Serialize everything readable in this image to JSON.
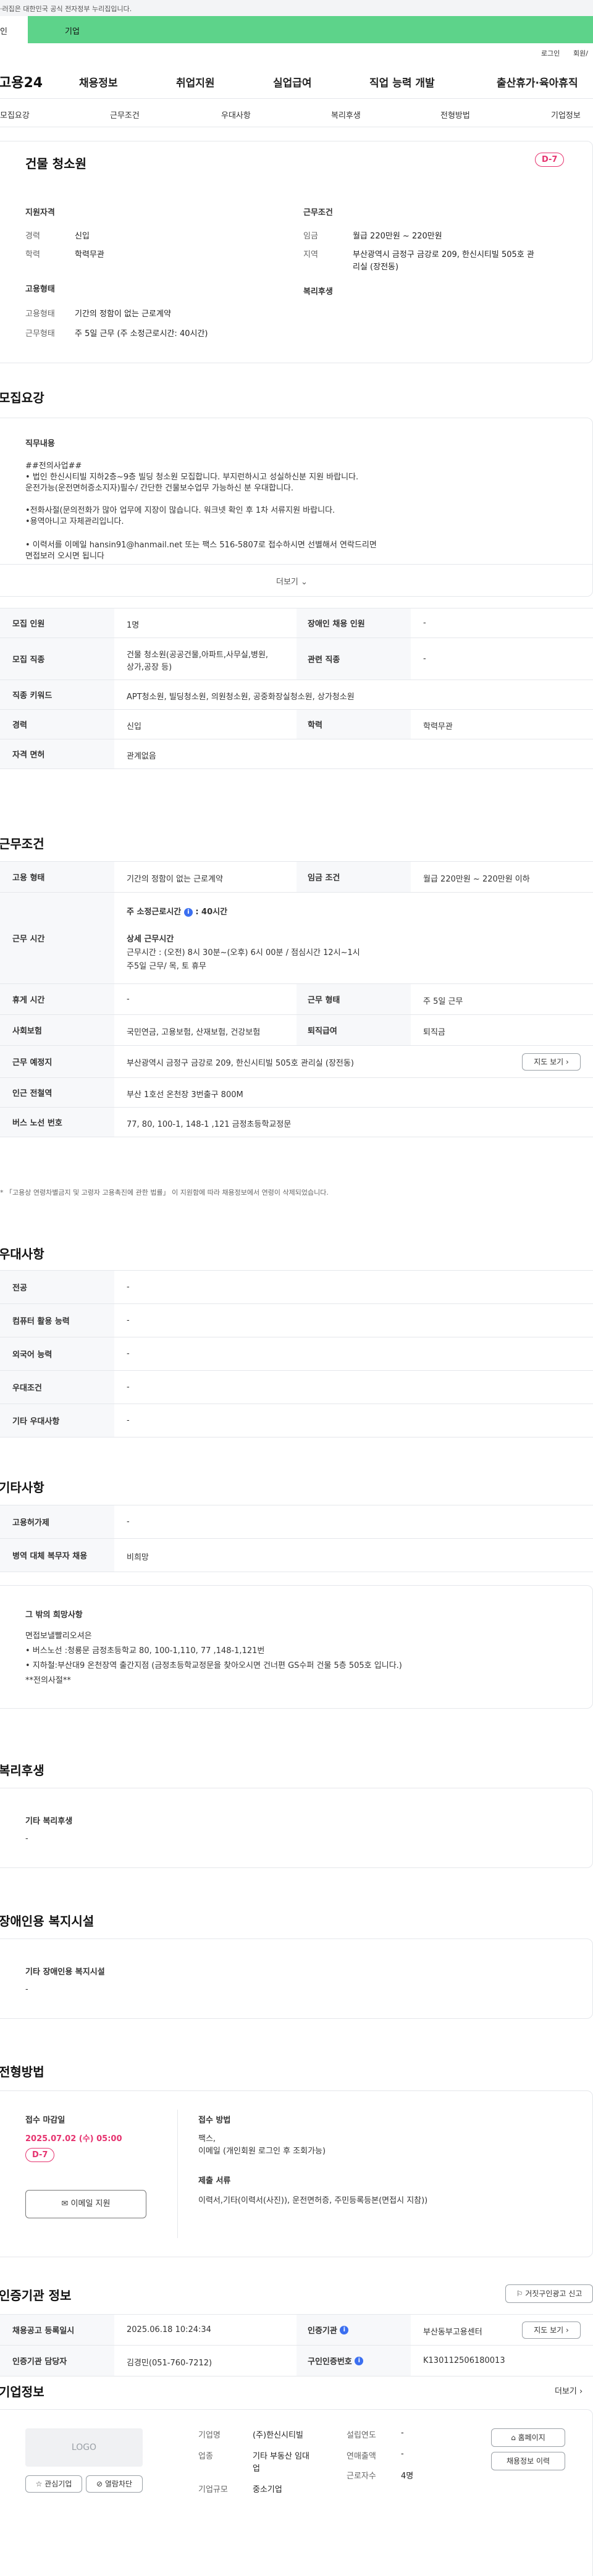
{
  "topbar": {
    "notice": "·러집은 대한민국 공식 전자정부 누리집입니다."
  },
  "user_tabs": {
    "personal": "인",
    "corporate": "기업"
  },
  "util": {
    "login": "로그인",
    "signup": "회원/"
  },
  "gnb": {
    "logo": "고용24",
    "items": [
      "채용정보",
      "취업지원",
      "실업급여",
      "직업 능력 개발",
      "출산휴가·육아휴직"
    ]
  },
  "anchors": [
    "모집요강",
    "근무조건",
    "우대사항",
    "복리후생",
    "전형방법",
    "기업정보"
  ],
  "summary": {
    "title": "건물 청소원",
    "dday": "D-7",
    "qual_heading": "지원자격",
    "career_label": "경력",
    "career_value": "신입",
    "edu_label": "학력",
    "edu_value": "학력무관",
    "cond_heading": "근무조건",
    "wage_label": "임금",
    "wage_value": "월급 220만원 ~ 220만원",
    "region_label": "지역",
    "region_value_1": "부산광역시 금정구 금강로 209, 한신시티빌 505호 관",
    "region_value_2": "리실 (장전동)",
    "emp_heading": "고용형태",
    "emp_type_label": "고용형태",
    "emp_type_value": "기간의 정함이 없는 근로계약",
    "work_type_label": "근무형태",
    "work_type_value": "주 5일 근무 (주 소정근로시간: 40시간)",
    "welfare_heading": "복리후생"
  },
  "recruit": {
    "heading": "모집요강",
    "job_heading": "직무내용",
    "lines": [
      "##전의사업##",
      "• 법인 한신시티빌 지하2층~9층 빌딩  청소원  모집합니다.  부지런하시고 성실하신분 지원 바랍니다.",
      "   운전가능(운전면허증소지자)필수/  간단한  건물보수업무 가능하신 분 우대합니다.",
      "",
      "•전화사절(문의전화가 많아 업무에 지장이 많습니다.  워크넷 확인 후 1차 서류지원 바랍니다.",
      "•용역아니고 자체관리입니다.",
      "",
      "• 이력서를  이메일 hansin91@hanmail.net  또는 팩스 516-5807로  접수하시면 선별해서 연락드리면",
      "   면접보러 오시면 됩니다"
    ],
    "more": "더보기"
  },
  "recruit_table": {
    "count_label": "모집 인원",
    "count_value": "1명",
    "disabled_label": "장애인 채용 인원",
    "disabled_value": "-",
    "job_label": "모집 직종",
    "job_value_1": "건물 청소원(공공건물,아파트,사무실,병원,",
    "job_value_2": "상가,공장 등)",
    "related_label": "관련 직종",
    "related_value": "-",
    "keyword_label": "직종 키워드",
    "keyword_value": "APT청소원, 빌딩청소원, 의원청소원, 공중화장실청소원, 상가청소원",
    "career_label": "경력",
    "career_value": "신입",
    "edu_label": "학력",
    "edu_value": "학력무관",
    "license_label": "자격 면허",
    "license_value": "관계없음"
  },
  "work": {
    "heading": "근무조건",
    "emp_label": "고용 형태",
    "emp_value": "기간의 정함이 없는 근로계약",
    "wage_label": "임금 조건",
    "wage_value": "월급 220만원 ~ 220만원 이하",
    "hours_label": "근무 시간",
    "hours_main": "주 소정근로시간",
    "hours_main_value": ": 40시간",
    "hours_detail_title": "상세 근무시간",
    "hours_detail_1": "근무시간 : (오전) 8시 30분~(오후) 6시 00분    /    점심시간 12시~1시",
    "hours_detail_2": "주5일 근무/    목, 토 휴무",
    "break_label": "휴게 시간",
    "break_value": "-",
    "worktype_label": "근무 형태",
    "worktype_value": "주 5일 근무",
    "insurance_label": "사회보험",
    "insurance_value": "국민연금, 고용보험, 산재보험, 건강보험",
    "severance_label": "퇴직급여",
    "severance_value": "퇴직금",
    "place_label": "근무 예정지",
    "place_value": "부산광역시 금정구 금강로 209, 한신시티빌 505호 관리실 (장전동)",
    "map_button": "지도 보기",
    "subway_label": "인근 전철역",
    "subway_value": "부산 1호선 온천장 3번출구 800M",
    "bus_label": "버스 노선 번호",
    "bus_value": "77, 80, 100-1, 148-1 ,121 금정초등학교정문",
    "note": "* 「고용상 연령차별금지 및 고령자 고용촉진에 관한 법률」 이 지원함에 따라 채용정보에서 연령이 삭제되었습니다."
  },
  "preference": {
    "heading": "우대사항",
    "rows": [
      {
        "label": "전공",
        "value": "-"
      },
      {
        "label": "컴퓨터 활용 능력",
        "value": "-"
      },
      {
        "label": "외국어 능력",
        "value": "-"
      },
      {
        "label": "우대조건",
        "value": "-"
      },
      {
        "label": "기타 우대사항",
        "value": "-"
      }
    ]
  },
  "etc": {
    "heading": "기타사항",
    "rows": [
      {
        "label": "고용허가제",
        "value": "-"
      },
      {
        "label": "병역 대체 복무자 채용",
        "value": "비희망"
      }
    ],
    "other_title": "그 밖의 희망사항",
    "other_lines": [
      "면접보낼빨리오셔은",
      "• 버스노선 :청룡문 금정초등학교 80, 100-1,110, 77 ,148-1,121번",
      "• 지하철:부산대9 온천장역 출간지점 (금정초등학교정문을 찾아오시면 건너편 GS수퍼 건물 5층 505호 입니다.)",
      "**전의사절**"
    ]
  },
  "welfare": {
    "heading": "복리후생",
    "box_title": "기타 복리후생",
    "box_value": "-"
  },
  "disability": {
    "heading": "장애인용 복지시설",
    "box_title": "기타 장애인용 복지시설",
    "box_value": "-"
  },
  "process": {
    "heading": "전형방법",
    "deadline_title": "접수 마감일",
    "deadline_value": "2025.07.02 (수) 05:00",
    "dday": "D-7",
    "email_button": "이메일 지원",
    "method_title": "접수 방법",
    "method_value_1": "팩스,",
    "method_value_2": "이메일 (개인회원 로그인 후 조회가능)",
    "docs_title": "제출 서류",
    "docs_value": "이력서,기타(이력서(사진)), 운전면허증, 주민등록등본(면접시 지참))"
  },
  "cert": {
    "heading": "인증기관 정보",
    "report_button": "거짓구인광고 신고",
    "reg_label": "채용공고 등록일시",
    "reg_value": "2025.06.18 10:24:34",
    "agency_label": "인증기관",
    "agency_value": "부산동부고용센터",
    "map_button": "지도 보기",
    "manager_label": "인증기관 담당자",
    "manager_value": "김경민(051-760-7212)",
    "jobno_label": "구인인증번호",
    "jobno_value": "K130112506180013"
  },
  "company": {
    "heading": "기업정보",
    "more": "더보기",
    "logo_text": "LOGO",
    "interest_button": "관심기업",
    "hide_button": "열람차단",
    "name_label": "기업명",
    "name_value": "(주)한신시티빌",
    "industry_label": "업종",
    "industry_value_1": "기타 부동산 임대",
    "industry_value_2": "업",
    "scale_label": "기업규모",
    "scale_value": "중소기업",
    "year_label": "설립연도",
    "year_value": "-",
    "revenue_label": "연매출액",
    "revenue_value": "-",
    "emp_label": "근로자수",
    "emp_value": "4명",
    "homepage_button": "홈페이지",
    "jobs_button": "채용정보 이력"
  },
  "colors": {
    "accent": "#5dd38a",
    "dday": "#e6336f",
    "info": "#3b6ff0"
  }
}
